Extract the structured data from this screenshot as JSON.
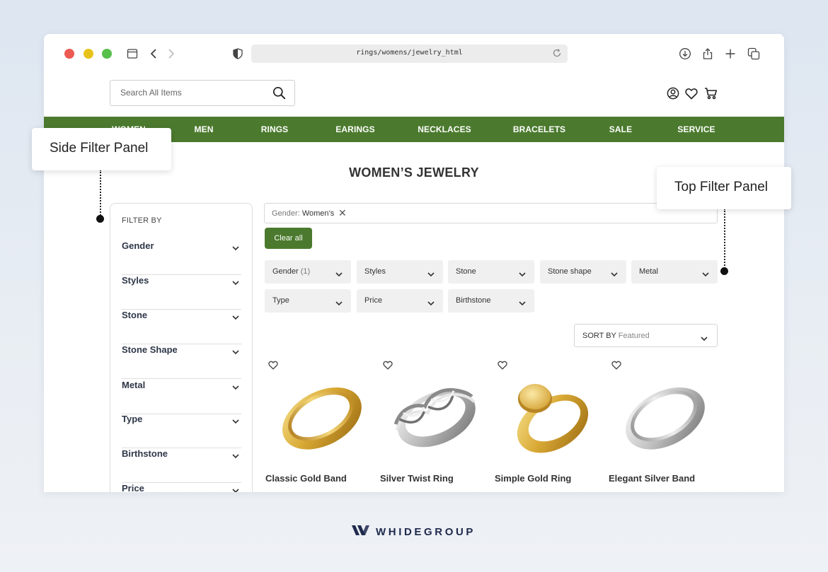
{
  "browser": {
    "url": "rings/womens/jewelry_html"
  },
  "header": {
    "search_placeholder": "Search All Items"
  },
  "nav": {
    "items": [
      "WOMEN",
      "MEN",
      "RINGS",
      "EARINGS",
      "NECKLACES",
      "BRACELETS",
      "SALE",
      "SERVICE"
    ]
  },
  "page": {
    "title": "WOMEN’S JEWELRY"
  },
  "side_filter": {
    "heading": "FILTER BY",
    "items": [
      "Gender",
      "Styles",
      "Stone",
      "Stone Shape",
      "Metal",
      "Type",
      "Birthstone",
      "Price"
    ]
  },
  "top_filter": {
    "active_tag": {
      "label": "Gender:",
      "value": "Women’s"
    },
    "clear_label": "Clear all",
    "chips": [
      {
        "label": "Gender",
        "count": "(1)"
      },
      {
        "label": "Styles"
      },
      {
        "label": "Stone"
      },
      {
        "label": "Stone shape"
      },
      {
        "label": "Metal"
      },
      {
        "label": "Type"
      },
      {
        "label": "Price"
      },
      {
        "label": "Birthstone"
      }
    ],
    "sort": {
      "label": "SORT BY",
      "value": "Featured"
    }
  },
  "products": [
    {
      "name": "Classic Gold Band",
      "metal": "gold"
    },
    {
      "name": "Silver Twist Ring",
      "metal": "silver"
    },
    {
      "name": "Simple Gold Ring",
      "metal": "gold"
    },
    {
      "name": "Elegant Silver Band",
      "metal": "silver"
    }
  ],
  "callouts": {
    "side": "Side Filter Panel",
    "top": "Top Filter Panel"
  },
  "brand": {
    "name": "WHIDEGROUP"
  },
  "colors": {
    "accent_green": "#4b7a2e",
    "background": "#dde6f1"
  }
}
